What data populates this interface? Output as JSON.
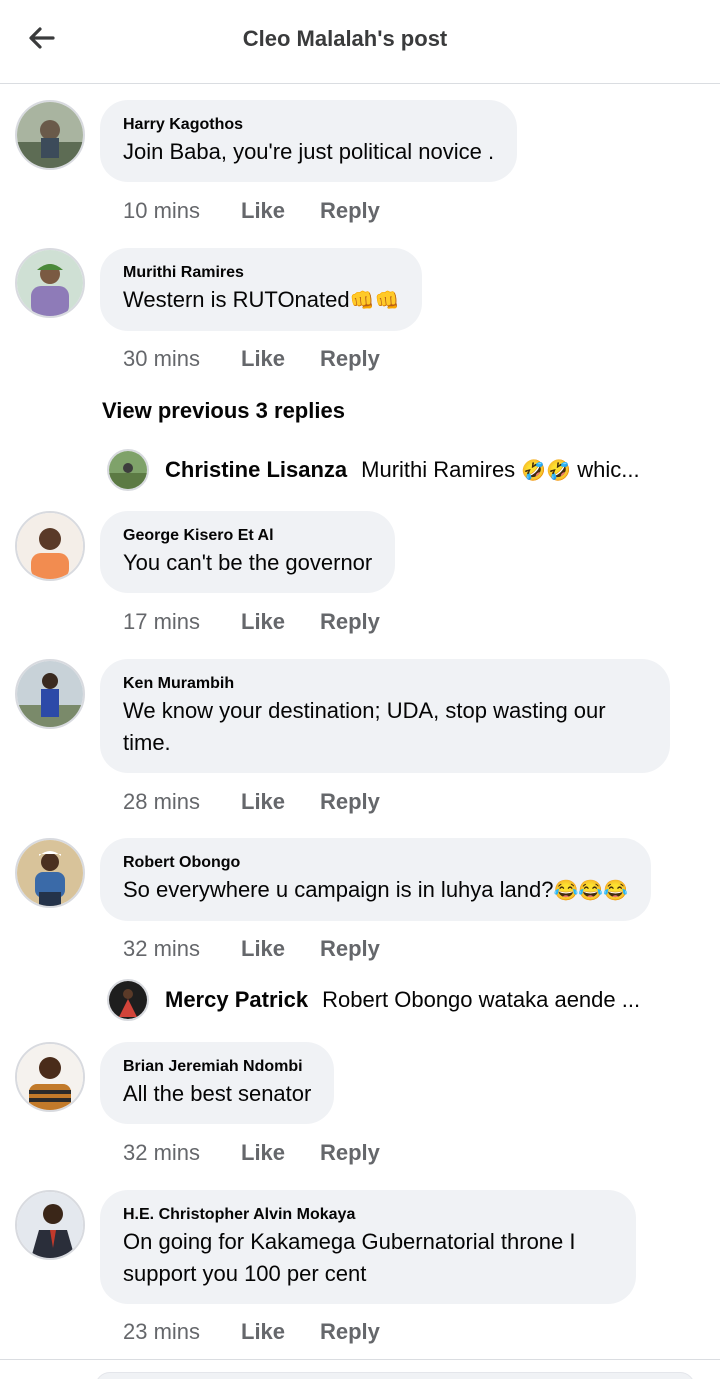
{
  "header": {
    "title": "Cleo Malalah's post"
  },
  "actions": {
    "like": "Like",
    "reply": "Reply"
  },
  "comments": [
    {
      "author": "Harry Kagothos",
      "text": "Join Baba, you're just political novice .",
      "time": "10 mins"
    },
    {
      "author": "Murithi Ramires",
      "text": "Western is RUTOnated",
      "emojis": "👊👊",
      "time": "30 mins"
    },
    {
      "author": "George Kisero Et Al",
      "text": "You can't be the governor",
      "time": "17 mins"
    },
    {
      "author": "Ken Murambih",
      "text": "We know your destination; UDA, stop wasting our time.",
      "time": "28 mins"
    },
    {
      "author": "Robert Obongo",
      "text": "So everywhere u campaign is in luhya land?",
      "emojis": "😂😂😂",
      "time": "32 mins"
    },
    {
      "author": "Brian Jeremiah Ndombi",
      "text": "All the best senator",
      "time": "32 mins"
    },
    {
      "author": "H.E. Christopher Alvin Mokaya",
      "text": "On going for Kakamega Gubernatorial throne I support you 100 per cent",
      "time": "23 mins"
    }
  ],
  "view_previous_replies": "View previous 3 replies",
  "reply_previews": [
    {
      "name": "Christine Lisanza",
      "text": "Murithi Ramires",
      "emojis": "🤣🤣",
      "tail": "whic..."
    },
    {
      "name": "Mercy Patrick",
      "text": "Robert Obongo wataka aende ..."
    }
  ],
  "colors": {
    "bubble": "#f0f2f5",
    "secondary_text": "#65676b",
    "divider": "#dadde1"
  }
}
